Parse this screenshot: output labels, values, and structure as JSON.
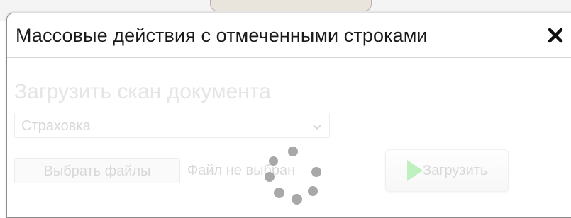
{
  "dialog": {
    "title": "Массовые действия с отмеченными строками",
    "close_icon": "close-icon"
  },
  "upload_section": {
    "heading": "Загрузить скан документа",
    "doc_type_select": {
      "selected": "Страховка"
    },
    "file_button_label": "Выбрать файлы",
    "file_status": "Файл не выбран",
    "upload_button_label": "Загрузить",
    "upload_icon": "play-icon"
  },
  "loading_indicator": {
    "icon": "spinner-icon",
    "dot_count": 7
  },
  "colors": {
    "disabled_text": "#d8d8d8",
    "upload_icon_green": "#bff0bf",
    "spinner_dot": "#a8a8a8"
  }
}
